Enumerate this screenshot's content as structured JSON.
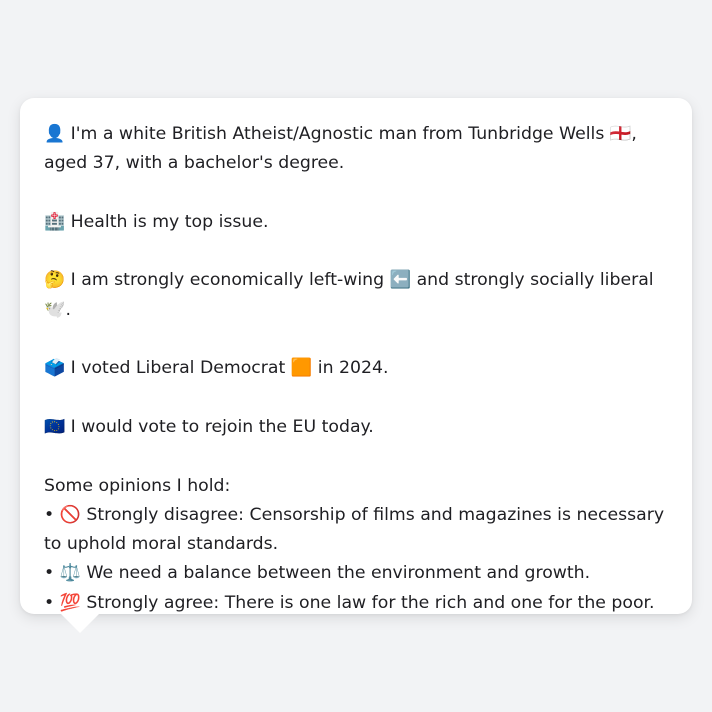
{
  "intro": {
    "emoji": "👤",
    "text": "I'm a white British Atheist/Agnostic man from Tunbridge Wells 🏴󠁧󠁢󠁥󠁮󠁧󠁿, aged 37, with a bachelor's degree."
  },
  "issue": {
    "emoji": "🏥",
    "text": "Health is my top issue."
  },
  "ideology": {
    "emoji": "🤔",
    "text": "I am strongly economically left-wing ⬅️ and strongly socially liberal 🕊️."
  },
  "vote": {
    "emoji": "🗳️",
    "text": "I voted Liberal Democrat 🟧 in 2024."
  },
  "eu": {
    "emoji": "🇪🇺",
    "text": "I would vote to rejoin the EU today."
  },
  "opinions": {
    "heading": "Some opinions I hold:",
    "items": [
      {
        "bullet": "•",
        "emoji": "🚫",
        "text": "Strongly disagree: Censorship of films and magazines is necessary to uphold moral standards."
      },
      {
        "bullet": "•",
        "emoji": "⚖️",
        "text": "We need a balance between the environment and growth."
      },
      {
        "bullet": "•",
        "emoji": "💯",
        "text": "Strongly agree: There is one law for the rich and one for the poor."
      }
    ]
  },
  "colors": {
    "background": "#f2f3f5",
    "bubble": "#ffffff",
    "text": "#1f1f23"
  }
}
